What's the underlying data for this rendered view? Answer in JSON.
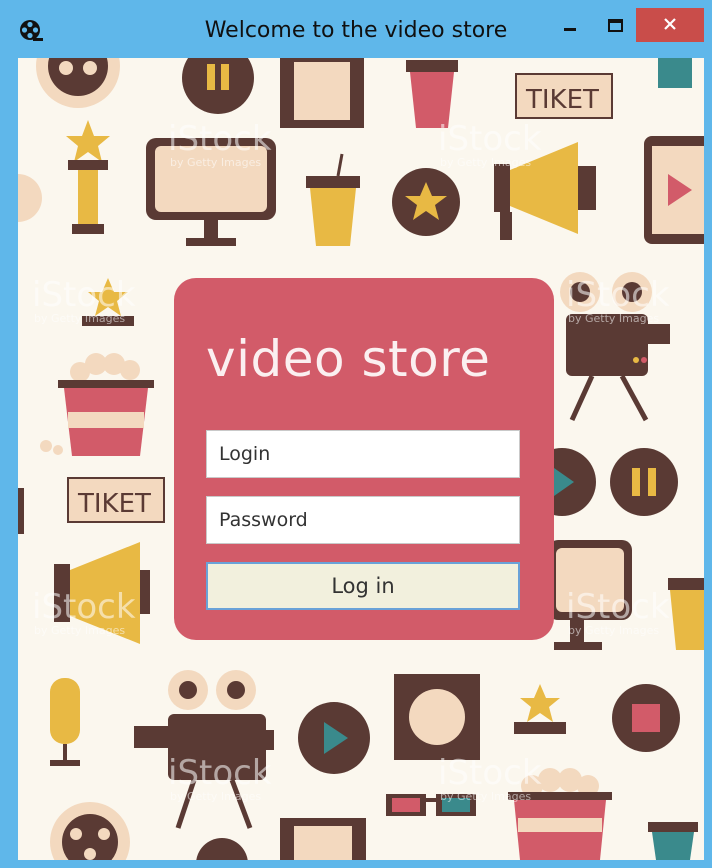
{
  "window": {
    "title": "Welcome to the video store",
    "minimize_glyph": "–",
    "maximize_glyph": "□",
    "close_glyph": "✕",
    "app_icon": "film-reel-icon"
  },
  "watermarks": [
    "iStock",
    "by Getty Images"
  ],
  "background_labels": [
    "TIKET"
  ],
  "login_card": {
    "title": "video store",
    "login_placeholder": "Login",
    "password_placeholder": "Password",
    "submit_label": "Log in"
  },
  "colors": {
    "titlebar": "#5fb7ea",
    "close_button": "#c94d4a",
    "card": "#d25b69",
    "background": "#fbf7ee",
    "brown": "#5a3a34",
    "yellow": "#e8b944",
    "peach": "#f3d9bf",
    "red": "#d25b69",
    "teal": "#3a8a8c"
  }
}
